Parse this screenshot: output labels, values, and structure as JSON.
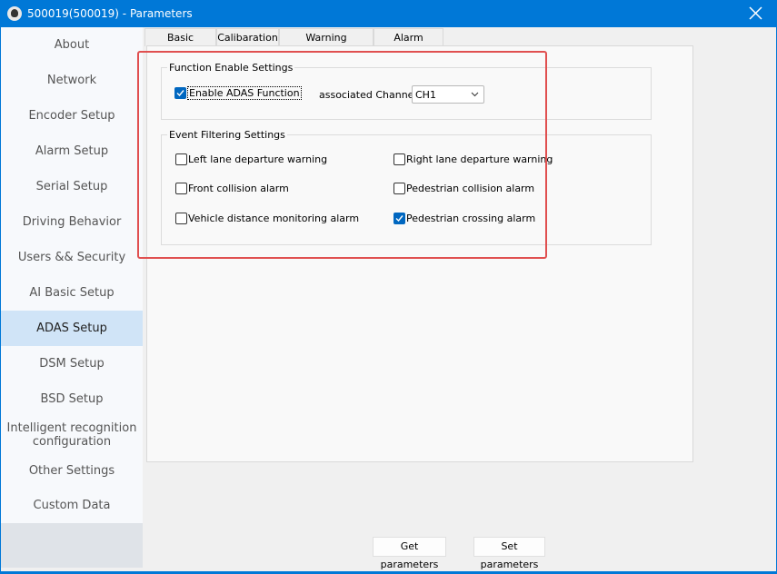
{
  "window": {
    "title": "500019(500019) - Parameters"
  },
  "sidebar": {
    "items": [
      {
        "label": "About"
      },
      {
        "label": "Network"
      },
      {
        "label": "Encoder Setup"
      },
      {
        "label": "Alarm Setup"
      },
      {
        "label": "Serial Setup"
      },
      {
        "label": "Driving Behavior"
      },
      {
        "label": "Users && Security"
      },
      {
        "label": "AI Basic Setup"
      },
      {
        "label": "ADAS Setup"
      },
      {
        "label": "DSM Setup"
      },
      {
        "label": "BSD Setup"
      },
      {
        "label": "Intelligent recognition configuration"
      },
      {
        "label": "Other Settings"
      },
      {
        "label": "Custom Data"
      }
    ],
    "selected": "ADAS Setup"
  },
  "tabs": [
    {
      "label": "Basic Function"
    },
    {
      "label": "Calibaration"
    },
    {
      "label": "Warning Sensitivity"
    },
    {
      "label": "Alarm Linkage"
    }
  ],
  "function_group": {
    "title": "Function Enable Settings",
    "enable_label": "Enable ADAS Function",
    "enable_checked": true,
    "channel_label": "associated Channel:",
    "channel_value": "CH1"
  },
  "event_group": {
    "title": "Event Filtering Settings",
    "items": [
      {
        "label": "Left lane departure warning",
        "checked": false
      },
      {
        "label": "Right lane departure warning",
        "checked": false
      },
      {
        "label": "Front collision alarm",
        "checked": false
      },
      {
        "label": "Pedestrian collision alarm",
        "checked": false
      },
      {
        "label": "Vehicle distance monitoring alarm",
        "checked": false
      },
      {
        "label": "Pedestrian crossing alarm",
        "checked": true
      }
    ]
  },
  "buttons": {
    "get": "Get parameters",
    "set": "Set parameters"
  },
  "colors": {
    "titlebar": "#0078d7",
    "selected_item": "#d0e4f7",
    "check": "#0067c0",
    "highlight": "#e05050"
  }
}
